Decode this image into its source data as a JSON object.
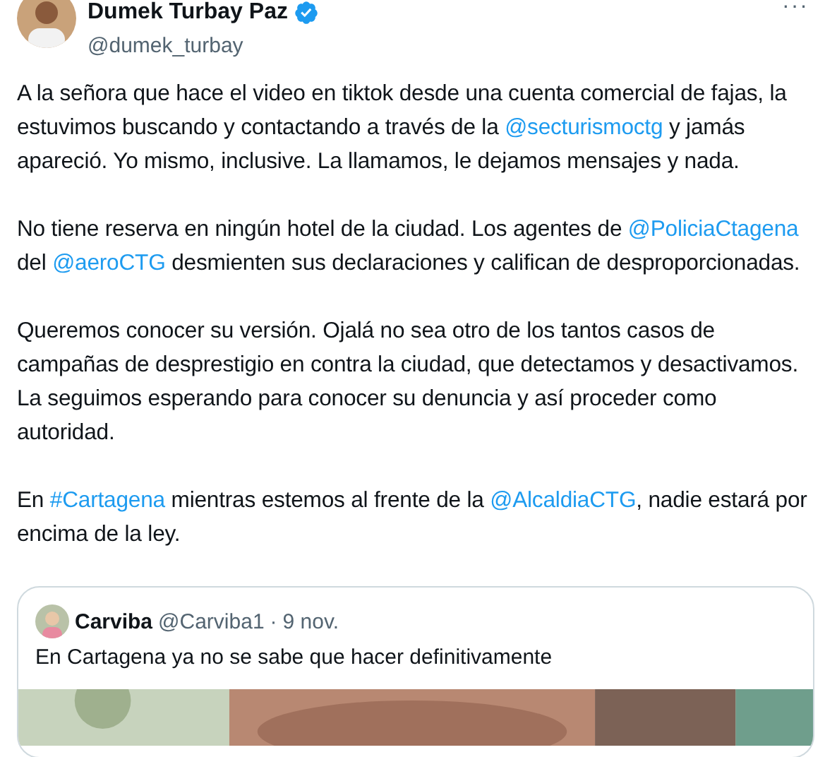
{
  "author": {
    "name": "Dumek Turbay Paz",
    "verified": true,
    "handle": "@dumek_turbay"
  },
  "more_label": "···",
  "paragraphs": [
    [
      {
        "kind": "plain",
        "text": "A la señora que hace el video en tiktok desde una cuenta comercial de fajas, la estuvimos buscando y contactando a través de la "
      },
      {
        "kind": "link",
        "text": "@secturismoctg"
      },
      {
        "kind": "plain",
        "text": " y jamás apareció. Yo mismo, inclusive. La llamamos, le dejamos mensajes y nada."
      }
    ],
    [
      {
        "kind": "plain",
        "text": "No tiene reserva en ningún hotel de la ciudad. Los agentes de "
      },
      {
        "kind": "link",
        "text": "@PoliciaCtagena"
      },
      {
        "kind": "plain",
        "text": " del "
      },
      {
        "kind": "link",
        "text": "@aeroCTG"
      },
      {
        "kind": "plain",
        "text": " desmienten sus declaraciones y califican de desproporcionadas."
      }
    ],
    [
      {
        "kind": "plain",
        "text": "Queremos conocer su versión. Ojalá no sea otro de los tantos casos de campañas de desprestigio en contra la ciudad, que detectamos y desactivamos. La seguimos esperando para conocer su denuncia y así proceder como autoridad."
      }
    ],
    [
      {
        "kind": "plain",
        "text": "En "
      },
      {
        "kind": "link",
        "text": "#Cartagena"
      },
      {
        "kind": "plain",
        "text": " mientras estemos al frente de la "
      },
      {
        "kind": "link",
        "text": "@AlcaldiaCTG"
      },
      {
        "kind": "plain",
        "text": ", nadie estará por encima de la ley."
      }
    ]
  ],
  "quote": {
    "name": "Carviba",
    "handle": "@Carviba1",
    "separator": "·",
    "date": "9 nov.",
    "text": "En Cartagena ya no se sabe que hacer definitivamente"
  }
}
